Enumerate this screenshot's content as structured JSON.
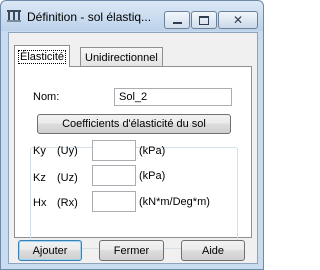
{
  "window": {
    "title": "Définition - sol élastiq...",
    "icon": "structure-icon",
    "controls": [
      "minimize",
      "maximize",
      "close"
    ]
  },
  "tabs": [
    {
      "label": "Élasticité",
      "active": true
    },
    {
      "label": "Unidirectionnel",
      "active": false
    }
  ],
  "form": {
    "name_label": "Nom:",
    "name_value": "Sol_2",
    "coeff_button": "Coefficients d'élasticité du sol",
    "rows": [
      {
        "label": "Ky",
        "sub": "(Uy)",
        "value": "",
        "unit": "(kPa)"
      },
      {
        "label": "Kz",
        "sub": "(Uz)",
        "value": "",
        "unit": "(kPa)"
      },
      {
        "label": "Hx",
        "sub": "(Rx)",
        "value": "",
        "unit": "(kN*m/Deg*m)"
      }
    ]
  },
  "buttons": {
    "add": "Ajouter",
    "close": "Fermer",
    "help": "Aide"
  }
}
